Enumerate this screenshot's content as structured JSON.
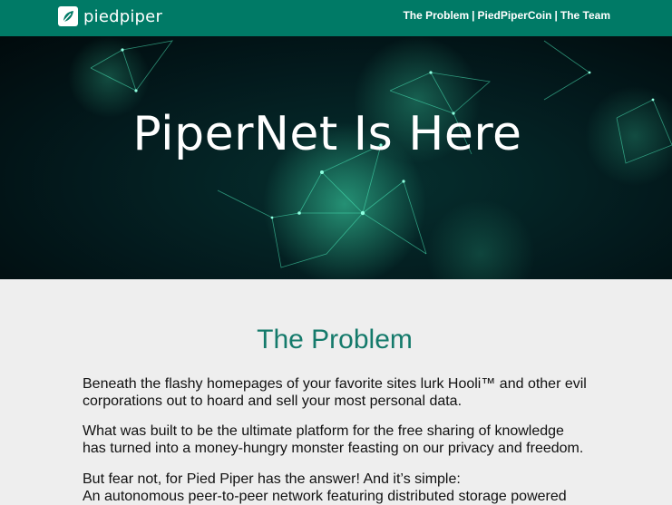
{
  "header": {
    "brand": "piedpiper",
    "nav": [
      "The Problem",
      "PiedPiperCoin",
      "The Team"
    ],
    "nav_separator": "|"
  },
  "hero": {
    "title": "PiperNet Is Here"
  },
  "problem": {
    "title": "The Problem",
    "paragraphs": [
      "Beneath the flashy homepages of your favorite sites lurk Hooli™ and other evil corporations out to hoard and sell your most personal data.",
      "What was built to be the ultimate platform for the free sharing of knowledge has turned into a money-hungry monster feasting on our privacy and freedom.",
      "But fear not, for Pied Piper has the answer! And it’s simple:",
      "An autonomous peer-to-peer network featuring distributed storage powered"
    ]
  },
  "colors": {
    "header_bg": "#007a66",
    "page_bg": "#eeeeee",
    "section_title": "#147a6b",
    "hero_glow": "#3fe3b0"
  },
  "icons": [
    "leaf-logo-icon"
  ]
}
